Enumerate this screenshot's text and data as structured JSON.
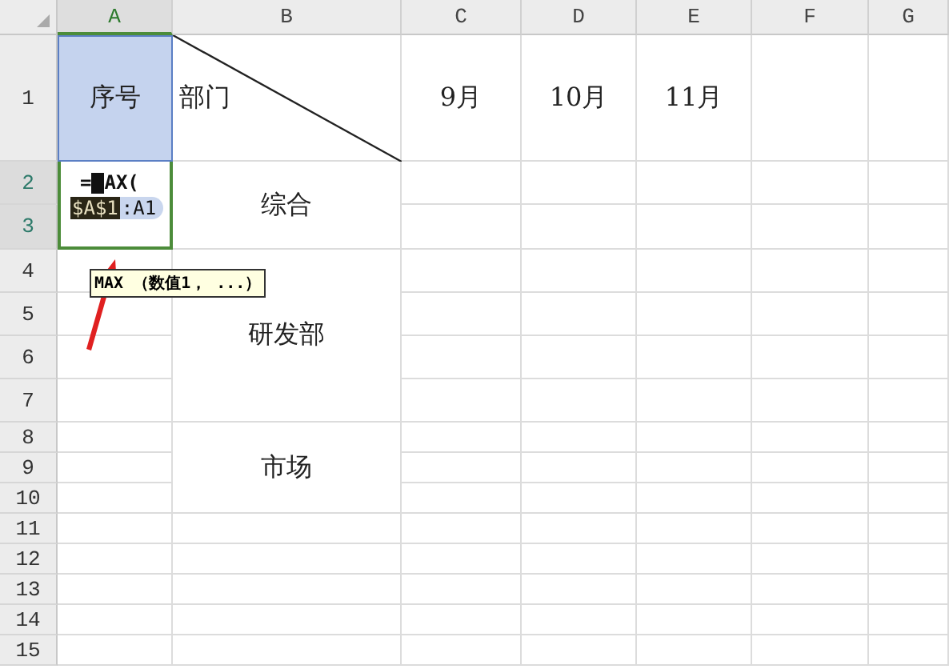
{
  "columns": [
    {
      "label": "A",
      "selected": true
    },
    {
      "label": "B",
      "selected": false
    },
    {
      "label": "C",
      "selected": false
    },
    {
      "label": "D",
      "selected": false
    },
    {
      "label": "E",
      "selected": false
    },
    {
      "label": "F",
      "selected": false
    },
    {
      "label": "G",
      "selected": false
    }
  ],
  "rows": [
    {
      "label": "1",
      "selected": false
    },
    {
      "label": "2",
      "selected": true
    },
    {
      "label": "3",
      "selected": true
    },
    {
      "label": "4",
      "selected": false
    },
    {
      "label": "5",
      "selected": false
    },
    {
      "label": "6",
      "selected": false
    },
    {
      "label": "7",
      "selected": false
    },
    {
      "label": "8",
      "selected": false
    },
    {
      "label": "9",
      "selected": false
    },
    {
      "label": "10",
      "selected": false
    },
    {
      "label": "11",
      "selected": false
    },
    {
      "label": "12",
      "selected": false
    },
    {
      "label": "13",
      "selected": false
    },
    {
      "label": "14",
      "selected": false
    },
    {
      "label": "15",
      "selected": false
    }
  ],
  "cells": [
    {
      "text": "序号",
      "referenced": true
    },
    {
      "text": "部门",
      "diagonal": true
    },
    {
      "text": "9月"
    },
    {
      "text": "10月"
    },
    {
      "text": "11月"
    },
    {
      "text": "综合"
    },
    {
      "text": "研发部"
    },
    {
      "text": "市场"
    }
  ],
  "editor": {
    "prefix": "=",
    "suffix": "AX(",
    "reference": "$A$1",
    "rest": ":A1"
  },
  "tooltip": {
    "text": "MAX （数值1， ...）"
  }
}
